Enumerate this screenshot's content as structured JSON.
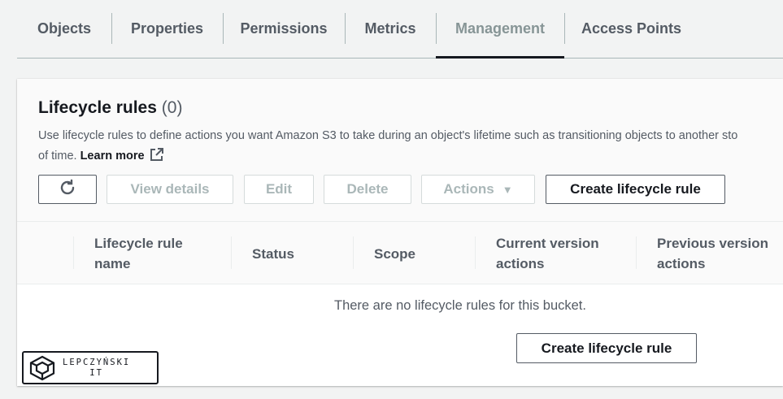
{
  "tabs": [
    {
      "label": "Objects"
    },
    {
      "label": "Properties"
    },
    {
      "label": "Permissions"
    },
    {
      "label": "Metrics"
    },
    {
      "label": "Management",
      "active": true
    },
    {
      "label": "Access Points"
    }
  ],
  "panel": {
    "title": "Lifecycle rules",
    "count": "(0)",
    "description_line1": "Use lifecycle rules to define actions you want Amazon S3 to take during an object's lifetime such as transitioning objects to another sto",
    "description_line2": "of time.",
    "learn_more": "Learn more"
  },
  "toolbar": {
    "refresh_icon": "refresh-icon",
    "view_details": "View details",
    "edit": "Edit",
    "delete": "Delete",
    "actions": "Actions",
    "actions_caret": "▼",
    "create": "Create lifecycle rule"
  },
  "table": {
    "columns": [
      {
        "line1": "Lifecycle rule",
        "line2": "name"
      },
      {
        "line1": "Status",
        "line2": ""
      },
      {
        "line1": "Scope",
        "line2": ""
      },
      {
        "line1": "Current version",
        "line2": "actions"
      },
      {
        "line1": "Previous version",
        "line2": "actions"
      }
    ]
  },
  "empty_state": {
    "message": "There are no lifecycle rules for this bucket.",
    "create_button": "Create lifecycle rule"
  },
  "watermark": {
    "line1": "LEPCZYŃSKI",
    "line2": "IT"
  },
  "colors": {
    "text_primary": "#16191f",
    "text_secondary": "#545b64",
    "disabled": "#aab7b8",
    "background": "#f2f3f3"
  }
}
